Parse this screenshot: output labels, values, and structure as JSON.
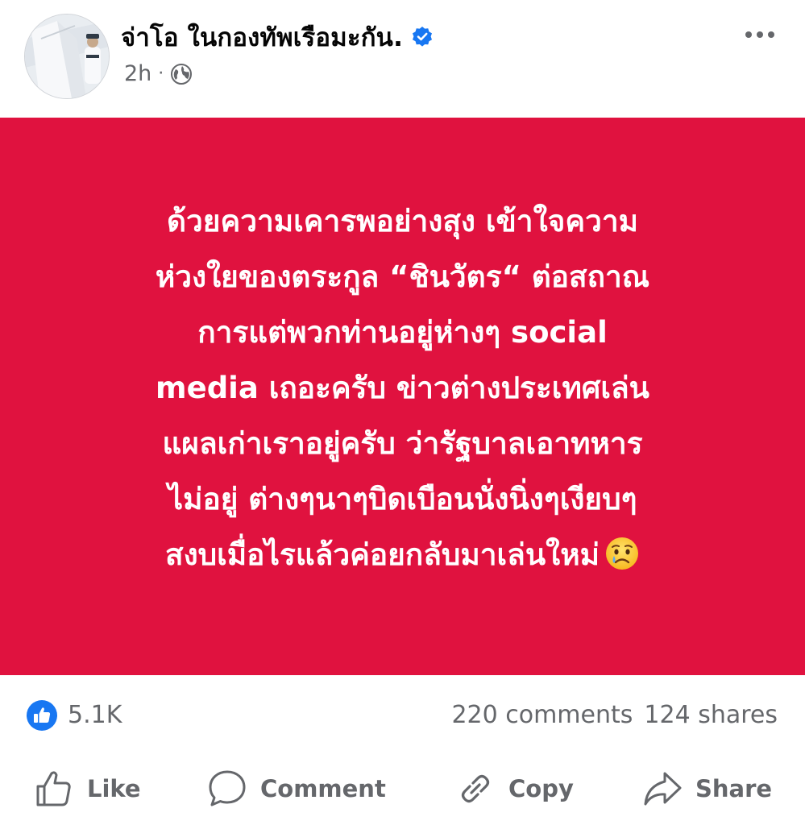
{
  "post": {
    "author": "จ่าโอ ในกองทัพเรือมะกัน.",
    "verified": true,
    "timestamp": "2h",
    "separator": "·",
    "audience_icon": "globe-icon",
    "menu_icon": "more-horizontal-icon"
  },
  "card": {
    "background_color": "#e0123f",
    "text_color": "#ffffff",
    "lines": [
      "ด้วยความเคารพอย่างสุง เข้าใจความ",
      "ห่วงใยของตระกูล “ชินวัตร“ ต่อสถาณ",
      "การแต่พวกท่านอยู่ห่างๆ social",
      "media เถอะครับ ข่าวต่างประเทศเล่น",
      "แผลเก่าเราอยู่ครับ ว่ารัฐบาลเอาทหาร",
      "ไม่อยู่ ต่างๆนาๆบิดเบือนนั่งนิ่งๆเงียบๆ",
      "สงบเมื่อไรแล้วค่อยกลับมาเล่นใหม่"
    ],
    "trailing_emoji": "crying-face-emoji"
  },
  "stats": {
    "reaction_icon": "like-reaction-icon",
    "reactions": "5.1K",
    "comments": "220 comments",
    "shares": "124 shares"
  },
  "actions": {
    "like": "Like",
    "comment": "Comment",
    "copy": "Copy",
    "share": "Share"
  },
  "colors": {
    "accent_blue": "#1877f2",
    "secondary_text": "#65676b"
  }
}
